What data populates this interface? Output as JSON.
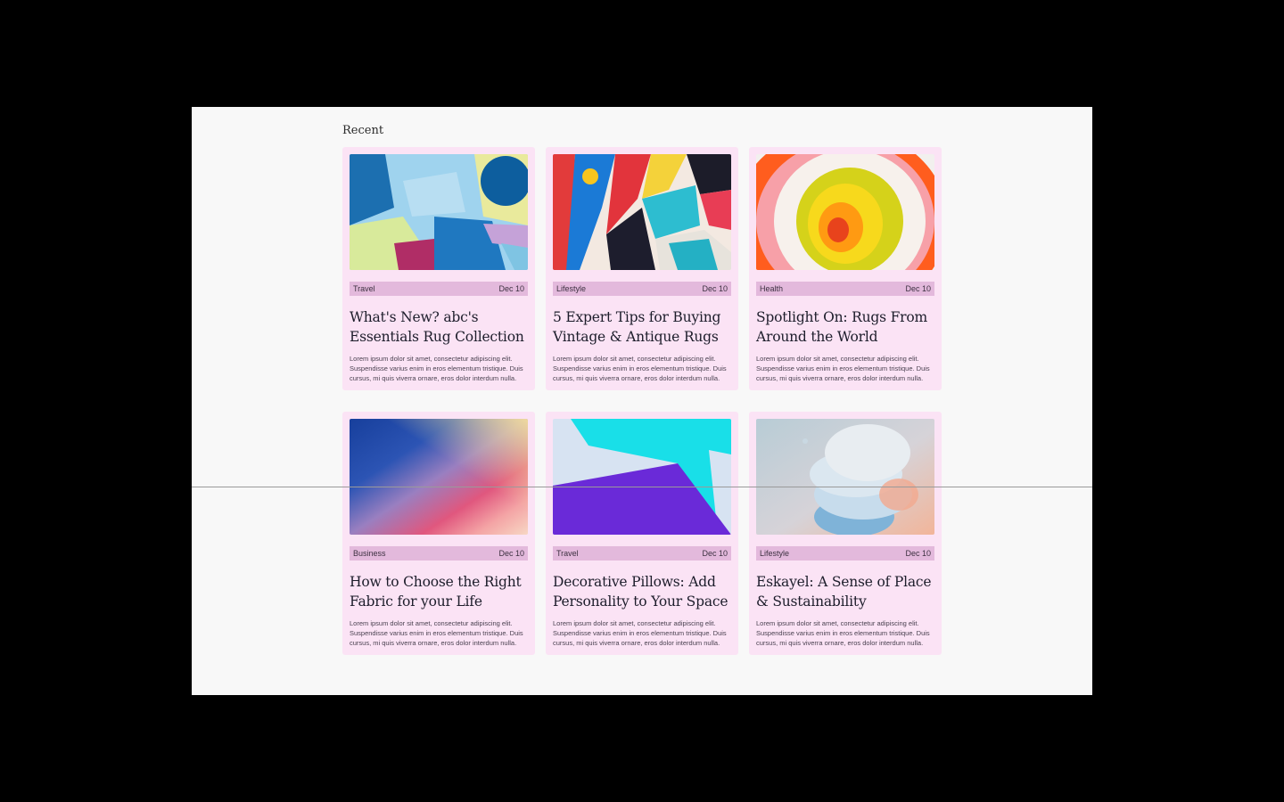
{
  "section": {
    "title": "Recent"
  },
  "cards": [
    {
      "category": "Travel",
      "date": "Dec 10",
      "title": "What's New? abc's Essentials Rug Collection",
      "excerpt": "Lorem ipsum dolor sit amet, consectetur adipiscing elit. Suspendisse varius enim in eros elementum tristique. Duis cursus, mi quis viverra ornare, eros dolor interdum nulla.",
      "image": "abstract-blue-yellow-shapes"
    },
    {
      "category": "Lifestyle",
      "date": "Dec 10",
      "title": "5 Expert Tips for Buying Vintage & Antique Rugs",
      "excerpt": "Lorem ipsum dolor sit amet, consectetur adipiscing elit. Suspendisse varius enim in eros elementum tristique. Duis cursus, mi quis viverra ornare, eros dolor interdum nulla.",
      "image": "colorful-mural-pattern"
    },
    {
      "category": "Health",
      "date": "Dec 10",
      "title": "Spotlight On: Rugs From Around the World",
      "excerpt": "Lorem ipsum dolor sit amet, consectetur adipiscing elit. Suspendisse varius enim in eros elementum tristique. Duis cursus, mi quis viverra ornare, eros dolor interdum nulla.",
      "image": "concentric-color-rings"
    },
    {
      "category": "Business",
      "date": "Dec 10",
      "title": "How to Choose the Right Fabric for your Life",
      "excerpt": "Lorem ipsum dolor sit amet, consectetur adipiscing elit. Suspendisse varius enim in eros elementum tristique. Duis cursus, mi quis viverra ornare, eros dolor interdum nulla.",
      "image": "gradient-blur"
    },
    {
      "category": "Travel",
      "date": "Dec 10",
      "title": "Decorative Pillows: Add Personality to Your Space",
      "excerpt": "Lorem ipsum dolor sit amet, consectetur adipiscing elit. Suspendisse varius enim in eros elementum tristique. Duis cursus, mi quis viverra ornare, eros dolor interdum nulla.",
      "image": "cyan-purple-wall"
    },
    {
      "category": "Lifestyle",
      "date": "Dec 10",
      "title": "Eskayel: A Sense of Place & Sustainability",
      "excerpt": "Lorem ipsum dolor sit amet, consectetur adipiscing elit. Suspendisse varius enim in eros elementum tristique. Duis cursus, mi quis viverra ornare, eros dolor interdum nulla.",
      "image": "3d-stacked-discs"
    }
  ],
  "colors": {
    "card_bg": "#fbe3f5",
    "meta_bg": "#e3b9dc",
    "canvas_bg": "#f8f8f8",
    "page_bg": "#000000"
  }
}
